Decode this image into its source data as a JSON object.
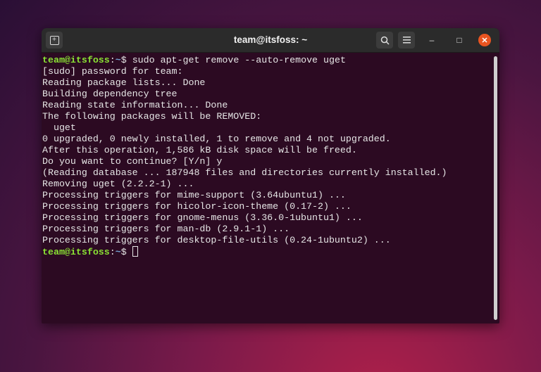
{
  "window": {
    "title": "team@itsfoss: ~"
  },
  "header": {
    "new_tab_icon": "new-tab-icon",
    "search_icon": "search-icon",
    "menu_icon": "hamburger-menu-icon",
    "minimize": "–",
    "maximize": "□",
    "close": "✕"
  },
  "terminal": {
    "prompt_user": "team@itsfoss",
    "prompt_sep": ":",
    "prompt_path": "~",
    "prompt_end": "$ ",
    "command": "sudo apt-get remove --auto-remove uget",
    "output": [
      "[sudo] password for team:",
      "Reading package lists... Done",
      "Building dependency tree",
      "Reading state information... Done",
      "The following packages will be REMOVED:",
      "  uget",
      "0 upgraded, 0 newly installed, 1 to remove and 4 not upgraded.",
      "After this operation, 1,586 kB disk space will be freed.",
      "Do you want to continue? [Y/n] y",
      "(Reading database ... 187948 files and directories currently installed.)",
      "Removing uget (2.2.2-1) ...",
      "Processing triggers for mime-support (3.64ubuntu1) ...",
      "Processing triggers for hicolor-icon-theme (0.17-2) ...",
      "Processing triggers for gnome-menus (3.36.0-1ubuntu1) ...",
      "Processing triggers for man-db (2.9.1-1) ...",
      "Processing triggers for desktop-file-utils (0.24-1ubuntu2) ..."
    ]
  }
}
